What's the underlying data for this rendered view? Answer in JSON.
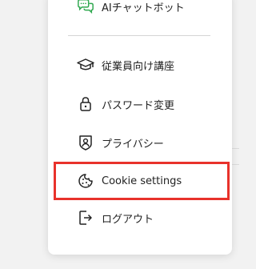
{
  "menu": {
    "items": [
      {
        "id": "ai-chatbot",
        "label": "AIチャットボット",
        "icon": "chat-bubbles-icon"
      },
      {
        "id": "employee-courses",
        "label": "従業員向け講座",
        "icon": "graduation-cap-icon"
      },
      {
        "id": "password-change",
        "label": "パスワード変更",
        "icon": "lock-icon"
      },
      {
        "id": "privacy",
        "label": "プライバシー",
        "icon": "user-shield-icon"
      },
      {
        "id": "cookie-settings",
        "label": "Cookie settings",
        "icon": "cookie-icon"
      },
      {
        "id": "logout",
        "label": "ログアウト",
        "icon": "logout-icon"
      }
    ]
  },
  "highlight": {
    "target": "cookie-settings",
    "color": "#e8322b"
  },
  "colors": {
    "chat_icon_green": "#2fa84f",
    "text": "#222222",
    "divider": "#d4d4d4"
  }
}
